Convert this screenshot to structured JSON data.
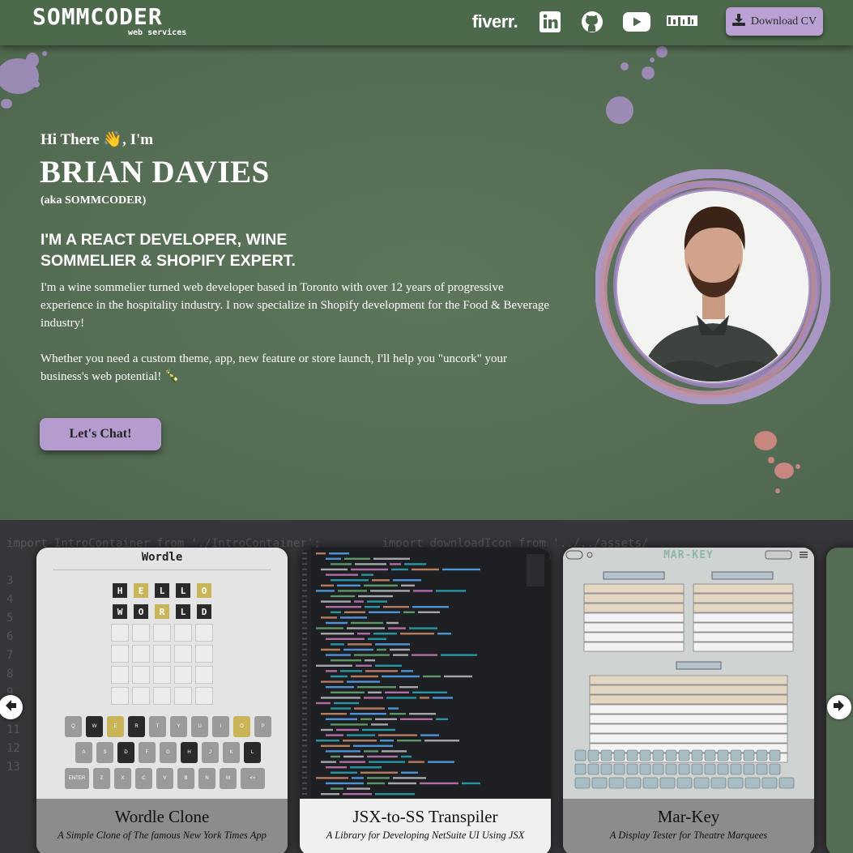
{
  "header": {
    "logo_main": "SOMMCODER",
    "logo_sub": "web services",
    "fiverr": "fiverr.",
    "cv_label": "Download CV"
  },
  "hero": {
    "greeting": "Hi There 👋, I'm",
    "name": "BRIAN DAVIES",
    "aka": "(aka SOMMCODER)",
    "role": "I'M A REACT DEVELOPER, WINE SOMMELIER & SHOPIFY EXPERT.",
    "bio1": "I'm a wine sommelier turned web developer based in Toronto with over 12 years of progressive experience in the hospitality industry. I now specialize in Shopify development for the Food & Beverage industry!",
    "bio2": "Whether you need a custom theme, app, new feature or store launch, I'll help you \"uncork\" your business's web potential! 🍾",
    "cta": "Let's Chat!"
  },
  "projects": [
    {
      "title": "Wordle Clone",
      "subtitle": "A Simple Clone of The famous New York Times App",
      "screen_title": "Wordle"
    },
    {
      "title": "JSX-to-SS Transpiler",
      "subtitle": "A Library for Developing NetSuite UI Using JSX"
    },
    {
      "title": "Mar-Key",
      "subtitle": "A Display Tester for Theatre Marquees",
      "screen_title": "MAR-KEY"
    }
  ],
  "wordle": {
    "row1": [
      "H",
      "E",
      "L",
      "L",
      "O"
    ],
    "row2": [
      "W",
      "O",
      "R",
      "L",
      "D"
    ],
    "keys1": [
      "Q",
      "W",
      "E",
      "R",
      "T",
      "Y",
      "U",
      "I",
      "O",
      "P"
    ],
    "keys2": [
      "A",
      "S",
      "D",
      "F",
      "G",
      "H",
      "J",
      "K",
      "L"
    ],
    "keys3": [
      "ENTER",
      "Z",
      "X",
      "C",
      "V",
      "B",
      "N",
      "M",
      "<="
    ]
  },
  "code_bg": "import IntroContainer from './IntroContainer';         import downloadIcon from '../../assets/\n\n3\n4\n5\n6\n7\n8\n9\n10\n11\n12\n13",
  "colors": {
    "header": "#4c6a4b",
    "accent_purple": "#b9a2d3",
    "hero_bg": "#566e55"
  }
}
